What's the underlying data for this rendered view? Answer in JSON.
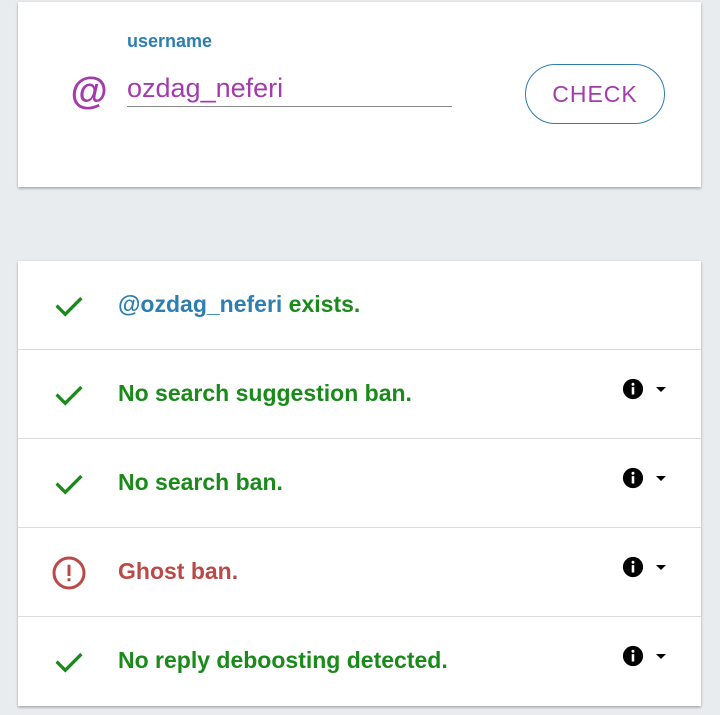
{
  "search": {
    "label": "username",
    "value": "ozdag_neferi",
    "at_symbol": "@",
    "button_label": "CHECK"
  },
  "results": [
    {
      "status": "ok",
      "icon": "check-icon",
      "handle": "@ozdag_neferi",
      "text": " exists.",
      "has_info": false
    },
    {
      "status": "ok",
      "icon": "check-icon",
      "text": "No search suggestion ban.",
      "has_info": true
    },
    {
      "status": "ok",
      "icon": "check-icon",
      "text": "No search ban.",
      "has_info": true
    },
    {
      "status": "bad",
      "icon": "alert-circle-icon",
      "text": "Ghost ban.",
      "has_info": true
    },
    {
      "status": "ok",
      "icon": "check-icon",
      "text": "No reply deboosting detected.",
      "has_info": true
    }
  ],
  "colors": {
    "accent_purple": "#a43bad",
    "accent_blue": "#2c7fb0",
    "ok_green": "#1a8a1a",
    "bad_red": "#b94a48",
    "background": "#e8ecef"
  }
}
